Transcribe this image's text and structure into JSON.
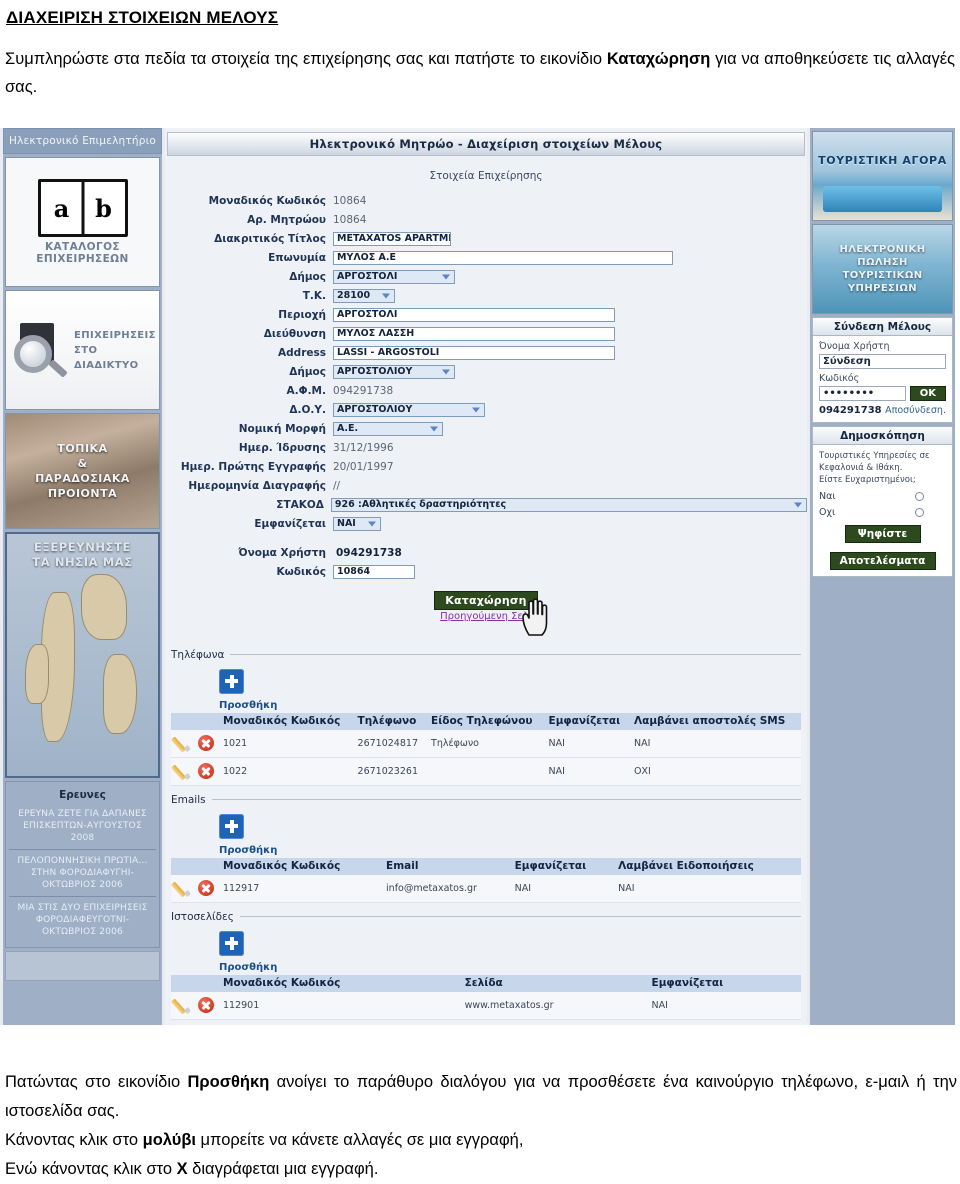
{
  "doc": {
    "title": "ΔΙΑΧΕΙΡΙΣΗ ΣΤΟΙΧΕΙΩΝ ΜΕΛΟΥΣ",
    "intro_part1": "Συμπληρώστε στα πεδία τα στοιχεία της επιχείρησης σας και πατήστε το εικονίδιο ",
    "intro_bold": "Καταχώρηση",
    "intro_part2": " για να αποθηκεύσετε τις αλλαγές σας.",
    "bottom_1a": "Πατώντας στο εικονίδιο ",
    "bottom_1b": "Προσθήκη",
    "bottom_1c": " ανοίγει το παράθυρο διαλόγου για να προσθέσετε ένα καινούργιο τηλέφωνο, ε-μαιλ ή την ιστοσελίδα σας.",
    "bottom_2a": "Κάνοντας κλικ στο ",
    "bottom_2b": "μολύβι",
    "bottom_2c": " μπορείτε να κάνετε αλλαγές σε μια εγγραφή,",
    "bottom_3a": "Ενώ κάνοντας κλικ στο ",
    "bottom_3b": "Χ",
    "bottom_3c": " διαγράφεται μια εγγραφή."
  },
  "left_sidebar": {
    "title": "Ηλεκτρονικό Επιμελητήριο",
    "catalog": {
      "letter_a": "a",
      "letter_b": "b",
      "line1": "ΚΑΤΑΛΟΓΟΣ",
      "line2": "ΕΠΙΧΕΙΡΗΣΕΩΝ"
    },
    "search_banner": {
      "line1": "ΕΠΙΧΕΙΡΗΣΕΙΣ",
      "line2": "ΣΤΟ",
      "line3": "ΔΙΑΔΙΚΤΥΟ"
    },
    "products_banner": {
      "line1": "ΤΟΠΙΚΑ",
      "line2": "&",
      "line3": "ΠΑΡΑΔΟΣΙΑΚΑ",
      "line4": "ΠΡΟΙΟΝΤΑ"
    },
    "map_banner": {
      "line1": "ΕΞΕΡΕΥΝΗΣΤΕ",
      "line2": "ΤΑ ΝΗΣΙΑ ΜΑΣ"
    },
    "research": {
      "heading": "Ερευνες",
      "items": [
        "ΕΡΕΥΝΑ ΖΕΤΕ ΓΙΑ ΔΑΠΑΝΕΣ ΕΠΙΣΚΕΠΤΩΝ-ΑΥΓΟΥΣΤΟΣ 2008",
        "ΠΕΛΟΠΟΝΝΗΣΙΚΗ ΠΡΩΤΙΑ…ΣΤΗΝ ΦΟΡΟΔΙΑΦΥΓΗΙ-ΟΚΤΩΒΡΙΟΣ 2006",
        "ΜΙΑ ΣΤΙΣ ΔΥΟ ΕΠΙΧΕΙΡΗΣΕΙΣ ΦΟΡΟΔΙΑΦΕΥΓΟΤΝΙ-ΟΚΤΩΒΡΙΟΣ 2006"
      ]
    }
  },
  "center": {
    "header": "Ηλεκτρονικό Μητρώο - Διαχείριση στοιχείων Μέλους",
    "subheader": "Στοιχεία Επιχείρησης",
    "fields": [
      {
        "label": "Μοναδικός Κωδικός",
        "value": "10864",
        "kind": "static"
      },
      {
        "label": "Αρ. Μητρώου",
        "value": "10864",
        "kind": "static"
      },
      {
        "label": "Διακριτικός Τίτλος",
        "value": "METAXATOS APARTMENTS",
        "kind": "input"
      },
      {
        "label": "Επωνυμία",
        "value": "ΜΥΛΟΣ Α.Ε",
        "kind": "input"
      },
      {
        "label": "Δήμος",
        "value": "ΑΡΓΟΣΤΟΛΙ",
        "kind": "select"
      },
      {
        "label": "Τ.Κ.",
        "value": "28100",
        "kind": "select"
      },
      {
        "label": "Περιοχή",
        "value": "ΑΡΓΟΣΤΟΛΙ",
        "kind": "input"
      },
      {
        "label": "Διεύθυνση",
        "value": "ΜΥΛΟΣ ΛΑΣΣΗ",
        "kind": "input"
      },
      {
        "label": "Address",
        "value": "LASSI - ARGOSTOLI",
        "kind": "input"
      },
      {
        "label": "Δήμος",
        "value": "ΑΡΓΟΣΤΟΛΙΟΥ",
        "kind": "select"
      },
      {
        "label": "Α.Φ.Μ.",
        "value": "094291738",
        "kind": "static"
      },
      {
        "label": "Δ.Ο.Υ.",
        "value": "ΑΡΓΟΣΤΟΛΙΟΥ",
        "kind": "select"
      },
      {
        "label": "Νομική Μορφή",
        "value": "Α.Ε.",
        "kind": "select"
      },
      {
        "label": "Ημερ. Ίδρυσης",
        "value": "31/12/1996",
        "kind": "static"
      },
      {
        "label": "Ημερ. Πρώτης Εγγραφής",
        "value": "20/01/1997",
        "kind": "static"
      },
      {
        "label": "Ημερομηνία Διαγραφής",
        "value": "//",
        "kind": "static"
      },
      {
        "label": "ΣΤΑΚΟΔ",
        "value": "926 :Αθλητικές δραστηριότητες",
        "kind": "select"
      },
      {
        "label": "Εμφανίζεται",
        "value": "ΝΑΙ",
        "kind": "select"
      },
      {
        "label": "Όνομα Χρήστη",
        "value": "094291738",
        "kind": "plain"
      },
      {
        "label": "Κωδικός",
        "value": "10864",
        "kind": "input"
      }
    ],
    "submit_button": "Καταχώρηση",
    "previous_link": "Προηγούμενη Σελ.",
    "sections": {
      "phones": {
        "title": "Τηλέφωνα",
        "add_label": "Προσθήκη",
        "columns": [
          "Μοναδικός Κωδικός",
          "Τηλέφωνο",
          "Είδος Τηλεφώνου",
          "Εμφανίζεται",
          "Λαμβάνει αποστολές SMS"
        ],
        "rows": [
          [
            "1021",
            "2671024817",
            "Τηλέφωνο",
            "ΝΑΙ",
            "ΝΑΙ"
          ],
          [
            "1022",
            "2671023261",
            "",
            "ΝΑΙ",
            "ΟΧΙ"
          ]
        ]
      },
      "emails": {
        "title": "Emails",
        "add_label": "Προσθήκη",
        "columns": [
          "Μοναδικός Κωδικός",
          "Email",
          "Εμφανίζεται",
          "Λαμβάνει Ειδοποιήσεις"
        ],
        "rows": [
          [
            "112917",
            "info@metaxatos.gr",
            "ΝΑΙ",
            "ΝΑΙ"
          ]
        ]
      },
      "websites": {
        "title": "Ιστοσελίδες",
        "add_label": "Προσθήκη",
        "columns": [
          "Μοναδικός Κωδικός",
          "Σελίδα",
          "Εμφανίζεται"
        ],
        "rows": [
          [
            "112901",
            "www.metaxatos.gr",
            "ΝΑΙ"
          ]
        ]
      }
    }
  },
  "right_sidebar": {
    "tourist_banner": "ΤΟΥΡΙΣΤΙΚΗ ΑΓΟΡΑ",
    "sales_banner": {
      "line1": "ΗΛΕΚΤΡΟΝΙΚΗ",
      "line2": "ΠΩΛΗΣΗ",
      "line3": "ΤΟΥΡΙΣΤΙΚΩΝ",
      "line4": "ΥΠΗΡΕΣΙΩΝ"
    },
    "login": {
      "title": "Σύνδεση Μέλους",
      "username_label": "Όνομα Χρήστη",
      "username_value": "Σύνδεση",
      "password_label": "Κωδικός",
      "password_value": "••••••••",
      "ok_button": "OK",
      "logged_user": "094291738",
      "logout_link": "Αποσύνδεση."
    },
    "poll": {
      "title": "Δημοσκόπηση",
      "question_l1": "Τουριστικές Υπηρεσίες σε",
      "question_l2": "Κεφαλονιά & Ιθάκη.",
      "question_l3": "Είστε Ευχαριστημένοι;",
      "option_yes": "Ναι",
      "option_no": "Οχι",
      "vote_button": "Ψηφίστε",
      "results_button": "Αποτελέσματα"
    }
  },
  "colors": {
    "panel_bg": "#eef1f5",
    "sidebar_bg": "#9fb0c6",
    "table_header": "#c7d6ea",
    "button_green": "#2d4a1f",
    "link_purple": "#8a2fa8",
    "add_icon_blue": "#1f63b5"
  }
}
